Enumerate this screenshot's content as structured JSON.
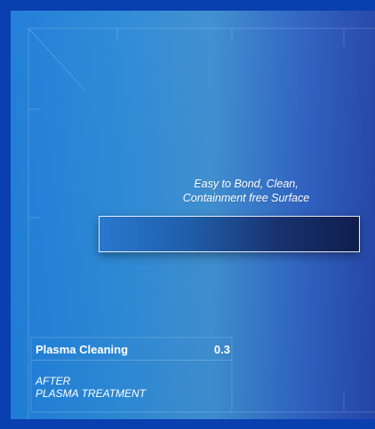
{
  "caption": {
    "line1": "Easy to Bond, Clean,",
    "line2": "Containment free Surface"
  },
  "info": {
    "title": "Plasma Cleaning",
    "value": "0.3",
    "sub_line1": "AFTER",
    "sub_line2": "PLASMA TREATMENT"
  },
  "colors": {
    "outer_background": "#0a3fb0",
    "panel_left": "#1f7ed8",
    "panel_right": "#2546a8",
    "bar_left": "#2a78cf",
    "bar_right": "#0f1d4c",
    "text": "#ffffff"
  }
}
